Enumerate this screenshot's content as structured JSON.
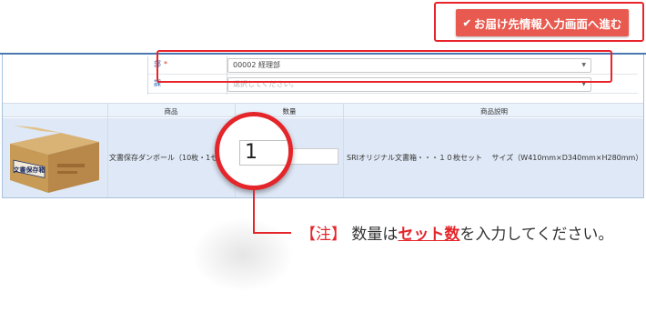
{
  "proceed_button": {
    "label": "お届け先情報入力画面へ進む",
    "icon": "check-icon"
  },
  "form": {
    "department": {
      "label": "部",
      "required_mark": "*",
      "value": "00002 経理部"
    },
    "section": {
      "label": "課",
      "placeholder": "選択してください。"
    }
  },
  "table": {
    "headers": {
      "product": "商品",
      "quantity": "数量",
      "description": "商品説明"
    },
    "row": {
      "image_label": "文書保存箱",
      "product_name": "文書保存ダンボール（10枚・1セ",
      "quantity": "1",
      "description": "SRIオリジナル文書箱・・・１０枚セット　 サイズ（W410mm×D340mm×H280mm）"
    }
  },
  "note": {
    "tag": "【注】",
    "text_before": "数量は",
    "emphasis": "セット数",
    "text_after": "を入力してください。"
  },
  "colors": {
    "highlight": "#e4262b",
    "button": "#e85a4f",
    "table_row": "#dfe8f6",
    "header": "#eaf2fb"
  }
}
